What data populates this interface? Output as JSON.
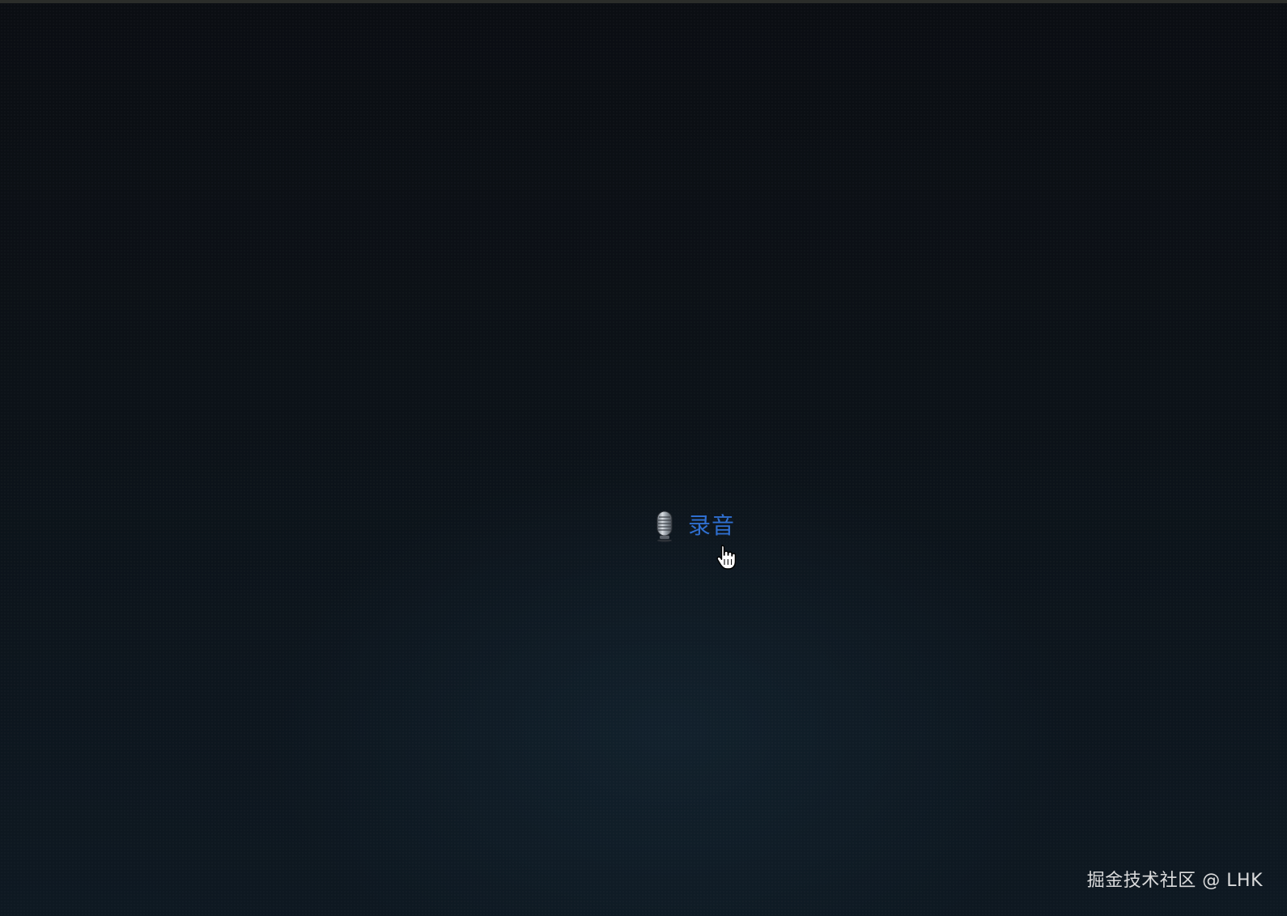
{
  "record_button": {
    "label": "录音",
    "icon": "microphone-icon",
    "label_color": "#2f6fd0"
  },
  "cursor": {
    "icon": "hand-pointer-icon"
  },
  "watermark": {
    "text": "掘金技术社区 @ LHK"
  },
  "colors": {
    "background": "#0c1218",
    "accent": "#2f6fd0"
  }
}
